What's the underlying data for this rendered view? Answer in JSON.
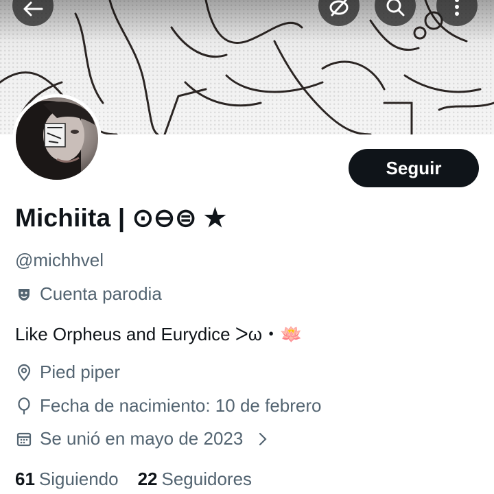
{
  "header": {
    "back_icon": "arrow-left-icon",
    "hide_icon": "eye-off-icon",
    "search_icon": "search-icon",
    "more_icon": "more-vertical-icon"
  },
  "profile": {
    "follow_label": "Seguir",
    "display_name": "Michiita | ⊙⊖⊜ ★",
    "handle": "@michhvel",
    "parody_label": "Cuenta parodia",
    "bio": "Like Orpheus and Eurydice  ᐳω・🪷",
    "location": "Pied piper",
    "birthday": "Fecha de nacimiento: 10 de febrero",
    "joined": "Se unió en mayo de 2023",
    "following_count": "61",
    "following_label": "Siguiendo",
    "followers_count": "22",
    "followers_label": "Seguidores"
  },
  "colors": {
    "text_primary": "#0f1419",
    "text_secondary": "#536471",
    "button_bg": "#0f1419"
  }
}
